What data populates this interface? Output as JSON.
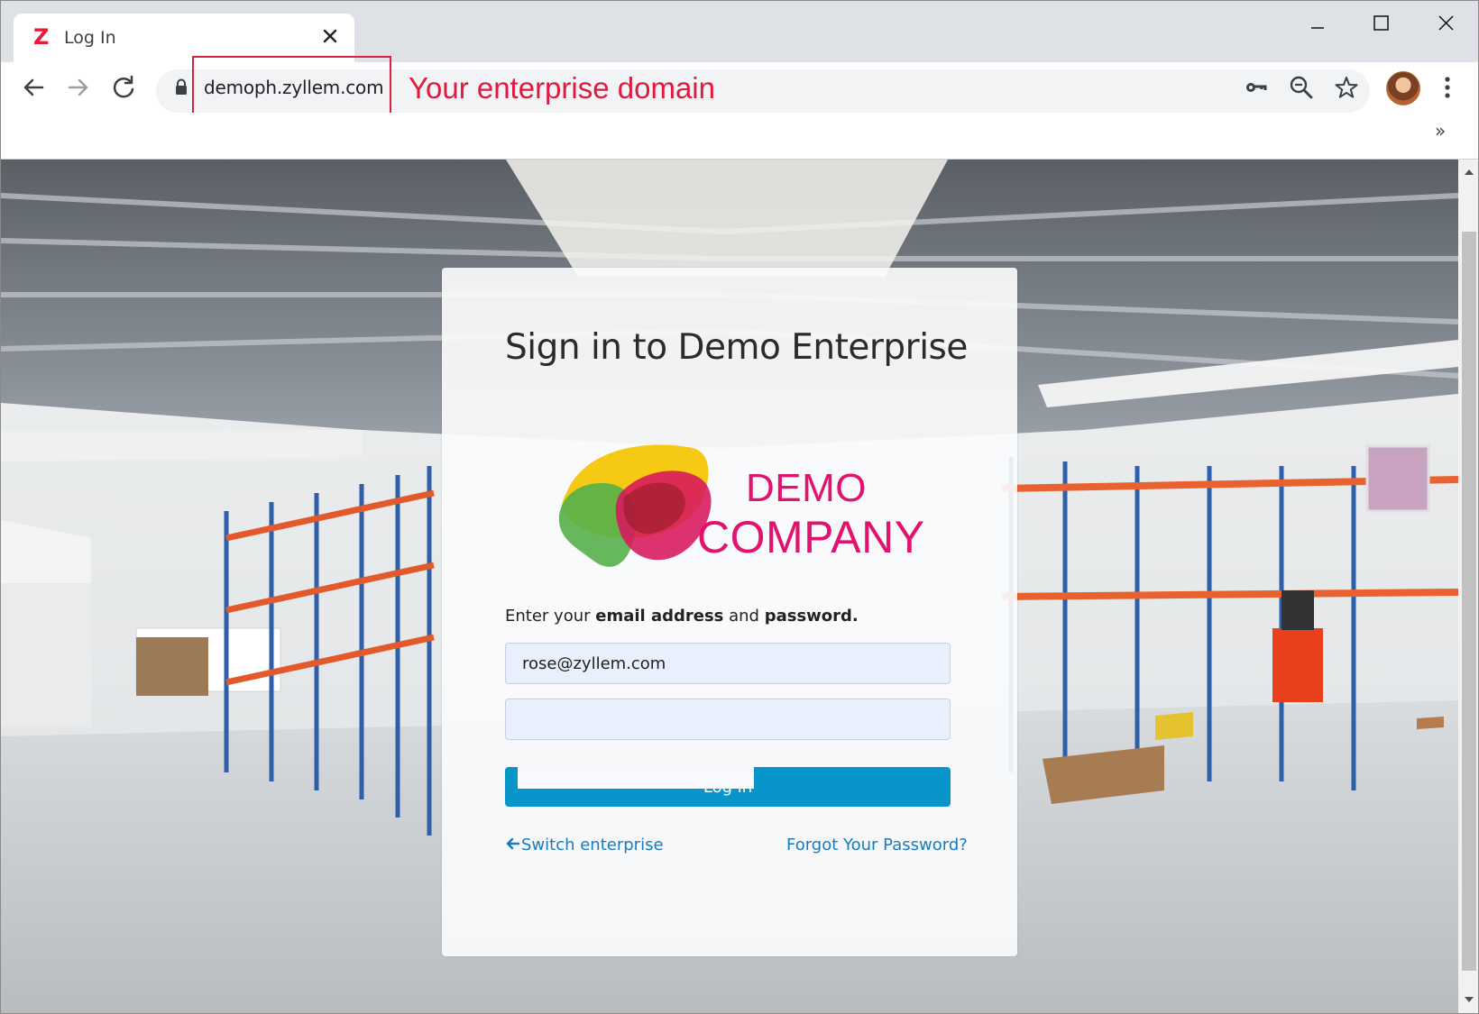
{
  "browser": {
    "tab_title": "Log In",
    "favicon_letter": "Z",
    "url": "demoph.zyllem.com",
    "annotation": "Your enterprise domain",
    "bookmarks_more": "»"
  },
  "login": {
    "title": "Sign in to Demo Enterprise",
    "logo_line1": "DEMO",
    "logo_line2": "COMPANY",
    "instruction_prefix": "Enter your ",
    "instruction_bold1": "email address",
    "instruction_mid": " and ",
    "instruction_bold2": "password.",
    "email_value": "rose@zyllem.com",
    "password_value": "",
    "login_button": "Log in",
    "switch_link": "Switch enterprise",
    "forgot_link": "Forgot Your Password?"
  },
  "colors": {
    "accent": "#0895c9",
    "brand": "#e1136f",
    "annotation": "#e0193f",
    "link": "#1a7bbd"
  }
}
